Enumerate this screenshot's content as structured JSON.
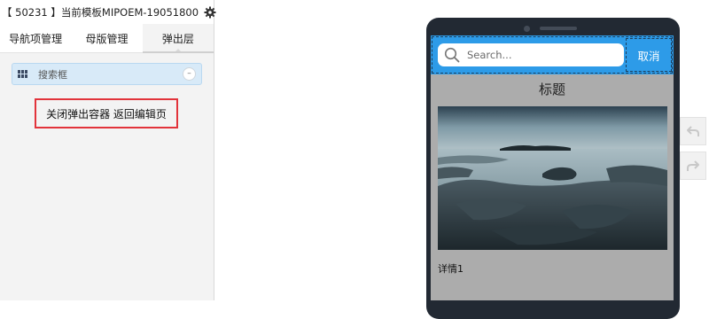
{
  "header": {
    "title": "【 50231 】当前模板MIPOEM-19051800"
  },
  "tabs": [
    {
      "label": "导航项管理"
    },
    {
      "label": "母版管理"
    },
    {
      "label": "弹出层"
    }
  ],
  "layer_item": {
    "label": "搜索框",
    "collapse_symbol": "–"
  },
  "close_popup_button": {
    "label": "关闭弹出容器 返回编辑页"
  },
  "preview": {
    "search_placeholder": "Search...",
    "cancel_label": "取消",
    "page_title": "标题",
    "detail_text": "详情1"
  },
  "colors": {
    "accent_blue": "#2d9be8",
    "highlight_red": "#e2333b",
    "selected_item_bg": "#d8eaf8",
    "screen_gray": "#acacac",
    "phone_frame": "#222933"
  },
  "icons": [
    "gear-icon",
    "grid-icon",
    "collapse-icon",
    "search-icon",
    "undo-icon",
    "redo-icon"
  ]
}
